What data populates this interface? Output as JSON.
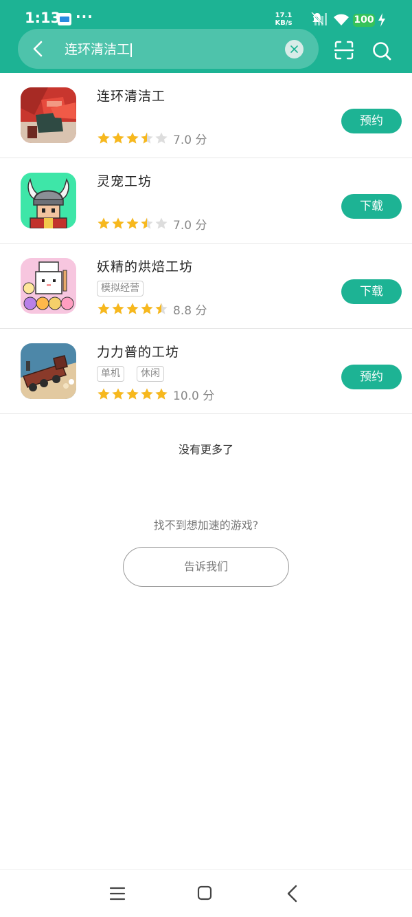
{
  "status_bar": {
    "time": "1:13",
    "dots": "···",
    "net_speed_value": "17.1",
    "net_speed_unit": "KB/s",
    "battery": "100"
  },
  "search": {
    "query": "连环清洁工"
  },
  "results": [
    {
      "name": "连环清洁工",
      "tags": [],
      "rating": 3.5,
      "score": "7.0 分",
      "action": "预约",
      "icon": "red-figure-game-icon"
    },
    {
      "name": "灵宠工坊",
      "tags": [],
      "rating": 3.5,
      "score": "7.0 分",
      "action": "下载",
      "icon": "viking-helmet-game-icon"
    },
    {
      "name": "妖精的烘焙工坊",
      "tags": [
        "模拟经营"
      ],
      "rating": 4.5,
      "score": "8.8 分",
      "action": "下载",
      "icon": "bunny-baker-game-icon"
    },
    {
      "name": "力力普的工坊",
      "tags": [
        "单机",
        "休闲"
      ],
      "rating": 5,
      "score": "10.0 分",
      "action": "预约",
      "icon": "train-workshop-game-icon"
    }
  ],
  "footer": {
    "no_more": "没有更多了",
    "cant_find": "找不到想加速的游戏?",
    "tell_us": "告诉我们"
  },
  "colors": {
    "accent": "#1db394",
    "star": "#f7b81d",
    "star_empty": "#dddddd"
  }
}
